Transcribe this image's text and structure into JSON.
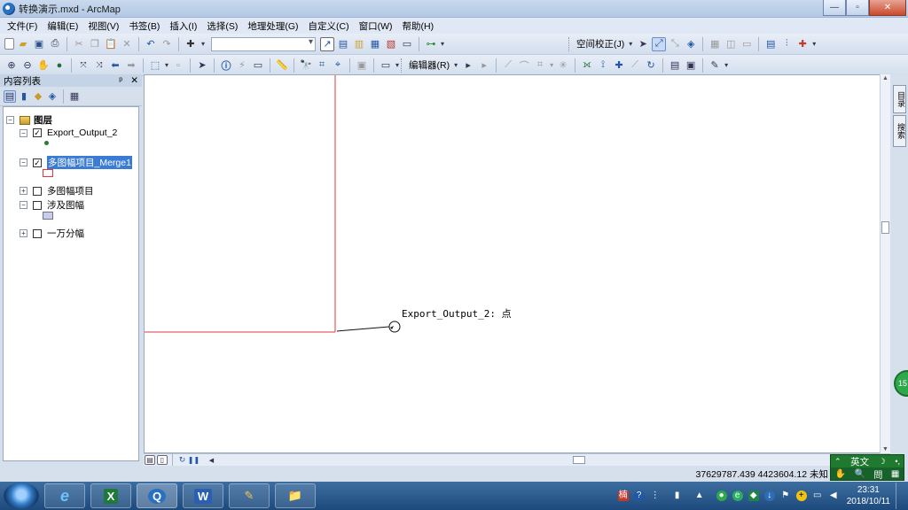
{
  "window": {
    "title": "转换演示.mxd - ArcMap",
    "minimize": "—",
    "maximize": "▫",
    "close": "✕"
  },
  "menu": [
    "文件(F)",
    "编辑(E)",
    "视图(V)",
    "书签(B)",
    "插入(I)",
    "选择(S)",
    "地理处理(G)",
    "自定义(C)",
    "窗口(W)",
    "帮助(H)"
  ],
  "toolbar": {
    "spatial_adjust_label": "空间校正(J)",
    "editor_label": "编辑器(R)",
    "scale_value": ""
  },
  "toc": {
    "title": "内容列表",
    "pin": "ᵖ",
    "close": "✕",
    "root_label": "图层",
    "layers": [
      {
        "name": "Export_Output_2",
        "checked": true,
        "expanded": true,
        "selected": false
      },
      {
        "name": "多图幅项目_Merge1",
        "checked": true,
        "expanded": true,
        "selected": true
      },
      {
        "name": "多图幅项目",
        "checked": false,
        "expanded": false,
        "selected": false
      },
      {
        "name": "涉及图幅",
        "checked": false,
        "expanded": true,
        "selected": false
      },
      {
        "name": "一万分幅",
        "checked": false,
        "expanded": false,
        "selected": false
      }
    ]
  },
  "map": {
    "label_text": "Export_Output_2: 点",
    "colors": {
      "polygon_outline": "#e0383f",
      "leader": "#111111",
      "background": "#ffffff",
      "point_symbol": "#2e7d32",
      "fill_symbol": "#c9cde6"
    }
  },
  "right_tabs": [
    "目录",
    "搜索"
  ],
  "status": {
    "coordinates": "37629787.439  4423604.12 未知"
  },
  "ime": {
    "lang": "英文",
    "icons": [
      "☽",
      "•,"
    ]
  },
  "green_badge": "15",
  "taskbar": {
    "apps": [
      "e",
      "X",
      "Q",
      "W",
      "✎",
      "📁"
    ],
    "clock_time": "23:31",
    "clock_date": "2018/10/11"
  }
}
